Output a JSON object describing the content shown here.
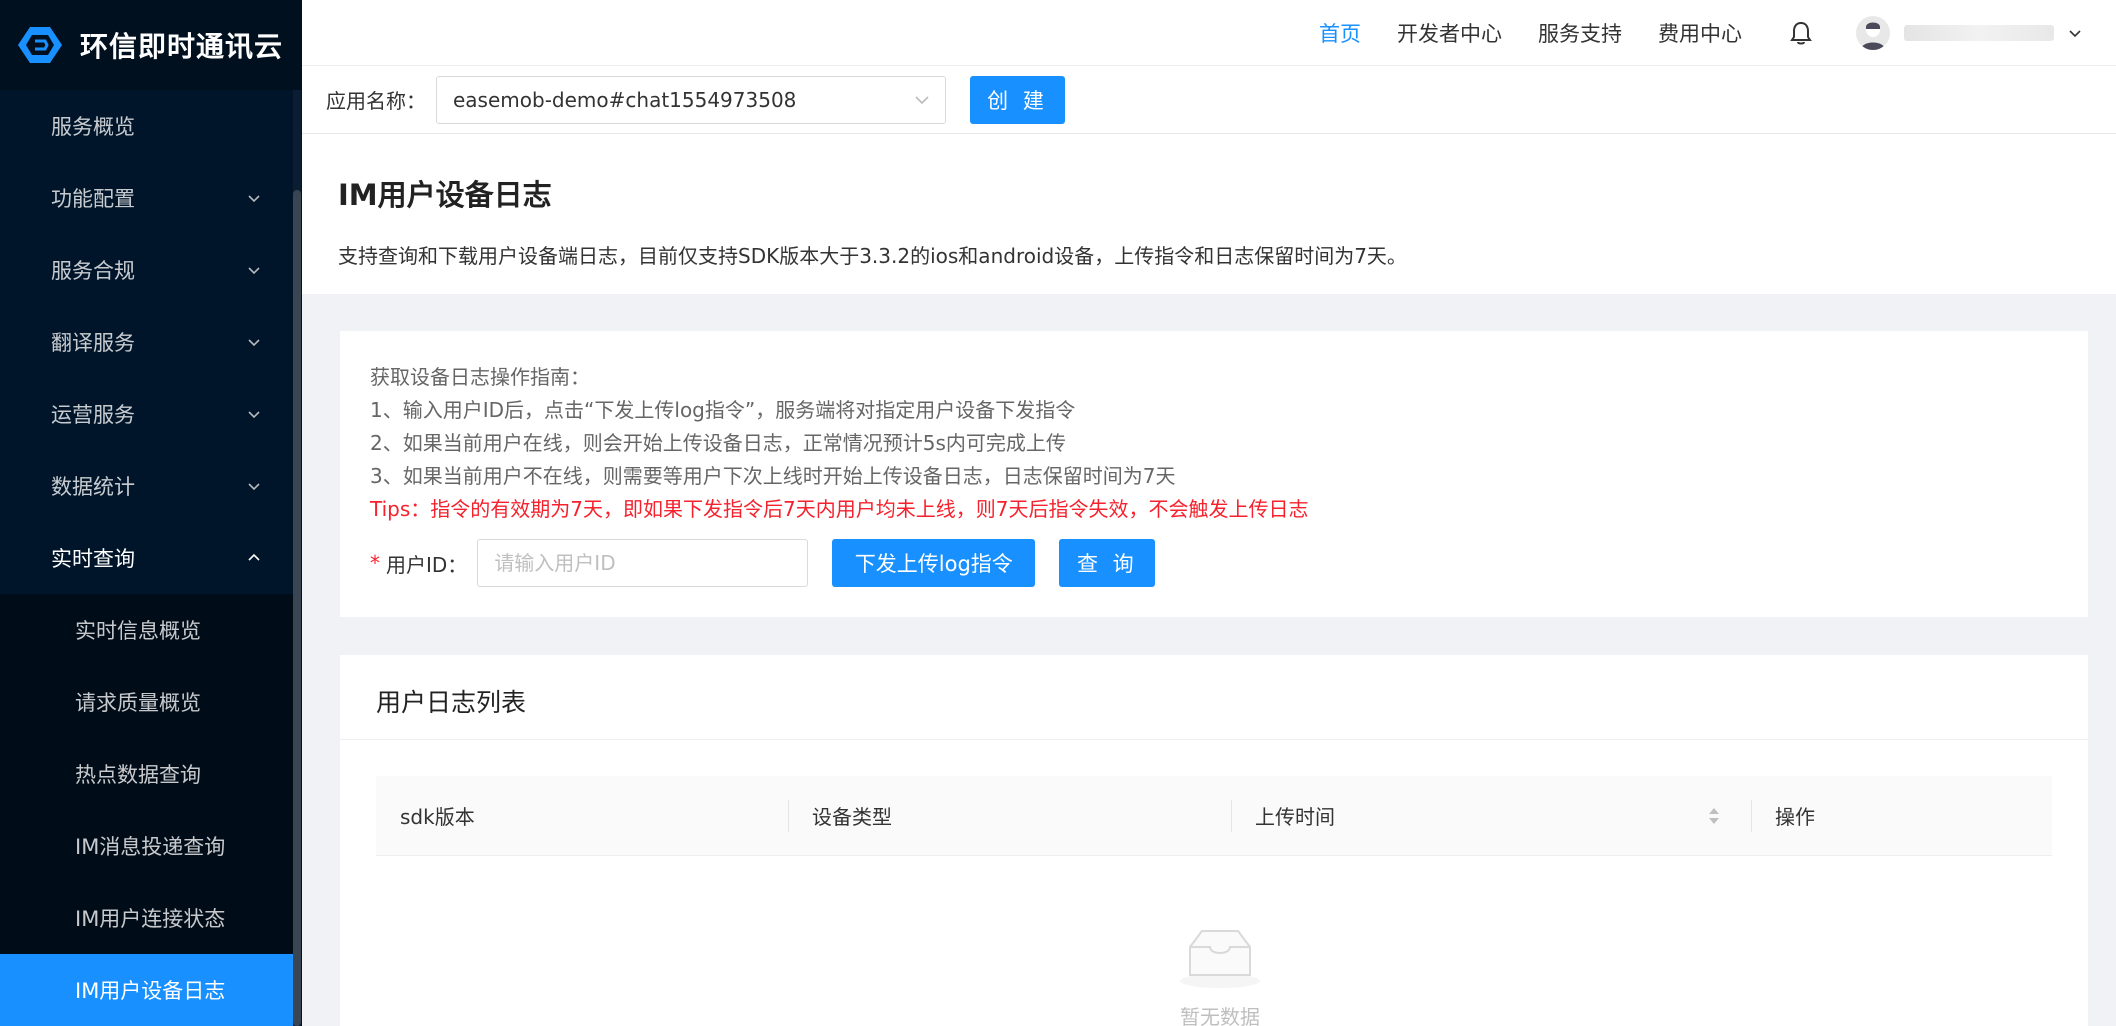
{
  "brand": {
    "name": "环信即时通讯云"
  },
  "sidebar": {
    "items": [
      {
        "label": "服务概览",
        "has_children": false
      },
      {
        "label": "功能配置",
        "has_children": true
      },
      {
        "label": "服务合规",
        "has_children": true
      },
      {
        "label": "翻译服务",
        "has_children": true
      },
      {
        "label": "运营服务",
        "has_children": true
      },
      {
        "label": "数据统计",
        "has_children": true
      },
      {
        "label": "实时查询",
        "has_children": true,
        "expanded": true
      }
    ],
    "subitems": [
      {
        "label": "实时信息概览"
      },
      {
        "label": "请求质量概览"
      },
      {
        "label": "热点数据查询"
      },
      {
        "label": "IM消息投递查询"
      },
      {
        "label": "IM用户连接状态"
      },
      {
        "label": "IM用户设备日志",
        "active": true
      }
    ]
  },
  "header": {
    "nav": [
      "首页",
      "开发者中心",
      "服务支持",
      "费用中心"
    ],
    "active_nav": "首页"
  },
  "appbar": {
    "label": "应用名称：",
    "selected_app": "easemob-demo#chat1554973508",
    "create_label": "创 建"
  },
  "page": {
    "title": "IM用户设备日志",
    "description": "支持查询和下载用户设备端日志，目前仅支持SDK版本大于3.3.2的ios和android设备，上传指令和日志保留时间为7天。"
  },
  "guide": {
    "heading": "获取设备日志操作指南：",
    "steps": [
      "1、输入用户ID后，点击“下发上传log指令”，服务端将对指定用户设备下发指令",
      "2、如果当前用户在线，则会开始上传设备日志，正常情况预计5s内可完成上传",
      "3、如果当前用户不在线，则需要等用户下次上线时开始上传设备日志，日志保留时间为7天"
    ],
    "tips": "Tips：指令的有效期为7天，即如果下发指令后7天内用户均未上线，则7天后指令失效，不会触发上传日志"
  },
  "form": {
    "required_mark": "*",
    "label": "用户ID：",
    "placeholder": "请输入用户ID",
    "upload_label": "下发上传log指令",
    "query_label": "查 询"
  },
  "list": {
    "title": "用户日志列表",
    "columns": [
      "sdk版本",
      "设备类型",
      "上传时间",
      "操作"
    ],
    "empty_text": "暂无数据"
  },
  "colors": {
    "primary": "#1890ff",
    "sidebar_bg": "#001529",
    "danger": "#f5222d"
  }
}
